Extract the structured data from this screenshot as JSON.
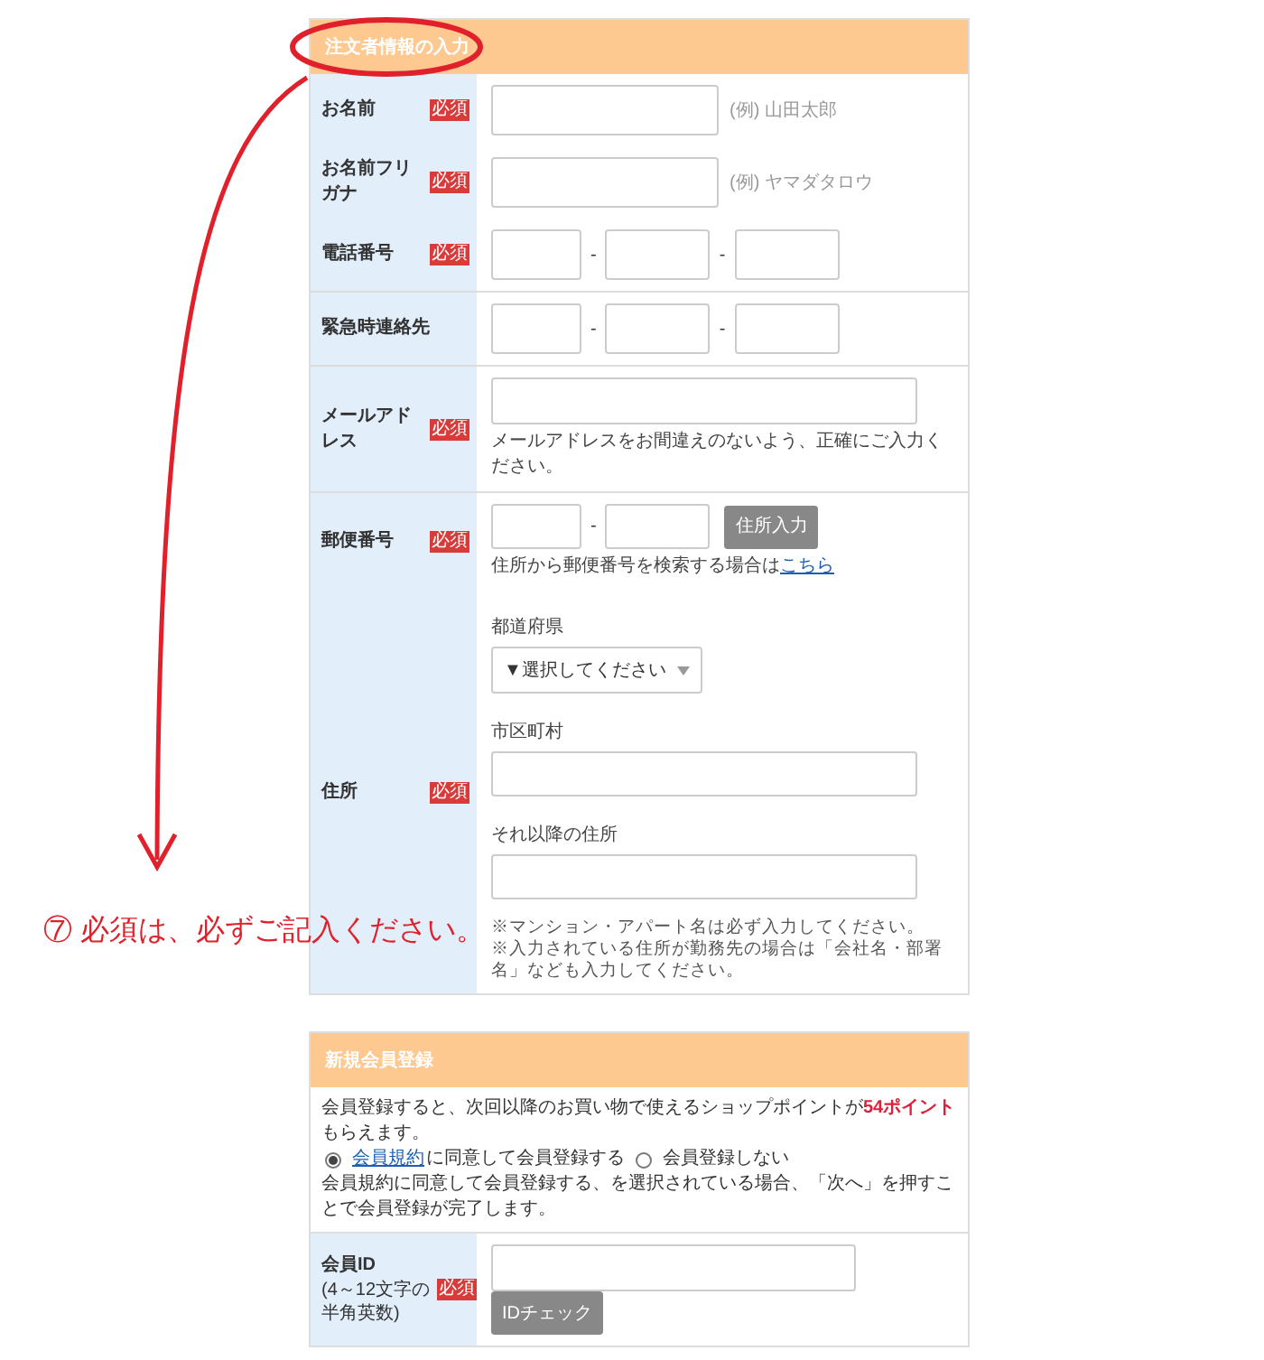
{
  "annotation": {
    "text": "⑦ 必須は、必ずご記入ください。"
  },
  "sections": [
    {
      "title": "注文者情報の入力",
      "circled": true,
      "groups": [
        {
          "rows": [
            {
              "kind": "text",
              "label": "お名前",
              "badge": "必須",
              "example": "(例) 山田太郎"
            },
            {
              "kind": "text",
              "label": "お名前フリガナ",
              "badge": "必須",
              "example": "(例) ヤマダタロウ"
            },
            {
              "kind": "phone",
              "label": "電話番号",
              "badge": "必須",
              "separators": [
                "-",
                "-"
              ]
            }
          ]
        },
        {
          "rows": [
            {
              "kind": "phone",
              "label": "緊急時連絡先",
              "separators": [
                "-",
                "-"
              ]
            }
          ]
        },
        {
          "rows": [
            {
              "kind": "email",
              "label": "メールアドレス",
              "badge": "必須",
              "note": "メールアドレスをお間違えのないよう、正確にご入力ください。"
            }
          ]
        },
        {
          "rows": [
            {
              "kind": "postal",
              "label": "郵便番号",
              "badge": "必須",
              "separator": "-",
              "button": "住所入力",
              "help": "住所から郵便番号を検索する場合は",
              "link": "こちら"
            },
            {
              "kind": "address",
              "label": "住所",
              "badge": "必須",
              "fields": [
                {
                  "kind": "select",
                  "label": "都道府県",
                  "value": "▼選択してください"
                },
                {
                  "kind": "text",
                  "label": "市区町村"
                },
                {
                  "kind": "text",
                  "label": "それ以降の住所"
                }
              ],
              "notes": [
                "※マンション・アパート名は必ず入力してください。",
                "※入力されている住所が勤務先の場合は「会社名・部署名」なども入力してください。"
              ]
            }
          ]
        }
      ]
    },
    {
      "title": "新規会員登録",
      "circled": false,
      "intro": "会員登録すると、次回以降のお買い物で使えるショップポイントが**54ポイント**もらえます。",
      "radios": [
        {
          "link": "会員規約",
          "label": "に同意して会員登録する",
          "selected": true
        },
        {
          "label": "会員登録しない",
          "selected": false
        }
      ],
      "note": "会員規約に同意して会員登録する、を選択されている場合、「次へ」を押すことで会員登録が完了します。",
      "groups": [
        {
          "rows": [
            {
              "kind": "member_id",
              "label": "会員ID",
              "sublabel": "(4～12文字の半角英数)",
              "badge": "必須",
              "button": "IDチェック"
            }
          ]
        }
      ]
    }
  ]
}
